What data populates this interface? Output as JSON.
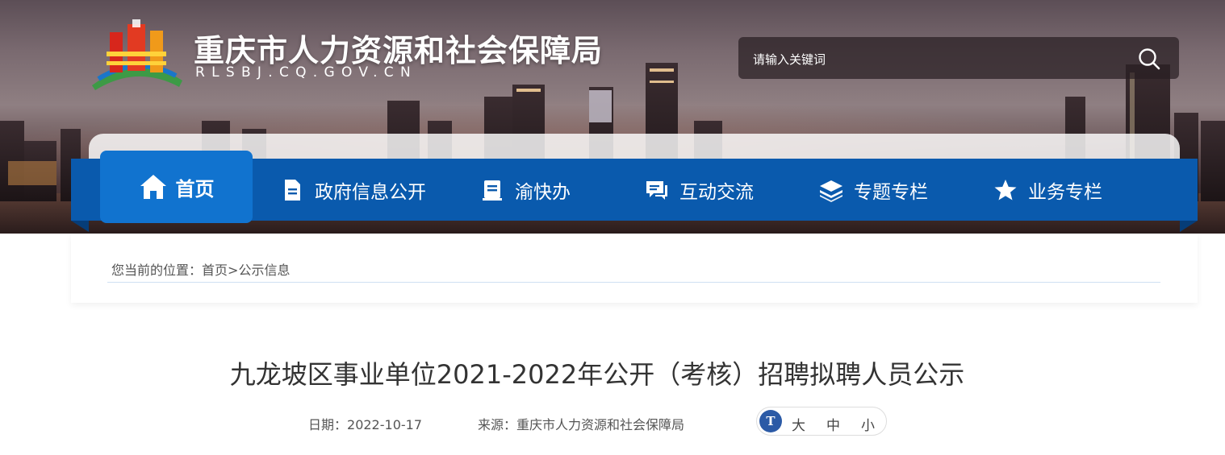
{
  "header": {
    "site_title": "重庆市人力资源和社会保障局",
    "site_domain": "RLSBJ.CQ.GOV.CN",
    "search_placeholder": "请输入关键词",
    "logo_icon": "government-emblem-icon"
  },
  "nav": {
    "items": [
      {
        "label": "首页",
        "icon": "home-icon",
        "active": true
      },
      {
        "label": "政府信息公开",
        "icon": "document-icon",
        "active": false
      },
      {
        "label": "渝快办",
        "icon": "clipboard-icon",
        "active": false
      },
      {
        "label": "互动交流",
        "icon": "chat-icon",
        "active": false
      },
      {
        "label": "专题专栏",
        "icon": "layers-icon",
        "active": false
      },
      {
        "label": "业务专栏",
        "icon": "star-icon",
        "active": false
      }
    ]
  },
  "breadcrumb": {
    "prefix": "您当前的位置：",
    "home": "首页",
    "separator": ">",
    "current": "公示信息"
  },
  "article": {
    "title": "九龙坡区事业单位2021-2022年公开（考核）招聘拟聘人员公示",
    "date_label": "日期：",
    "date": "2022-10-17",
    "source_label": "来源：",
    "source": "重庆市人力资源和社会保障局"
  },
  "font_size_control": {
    "icon_text": "T",
    "large": "大",
    "medium": "中",
    "small": "小"
  },
  "colors": {
    "nav_bg": "#0a5aad",
    "nav_active_bg": "#1173cf",
    "title_text": "#333333",
    "font_icon_bg": "#2b5aa6"
  }
}
